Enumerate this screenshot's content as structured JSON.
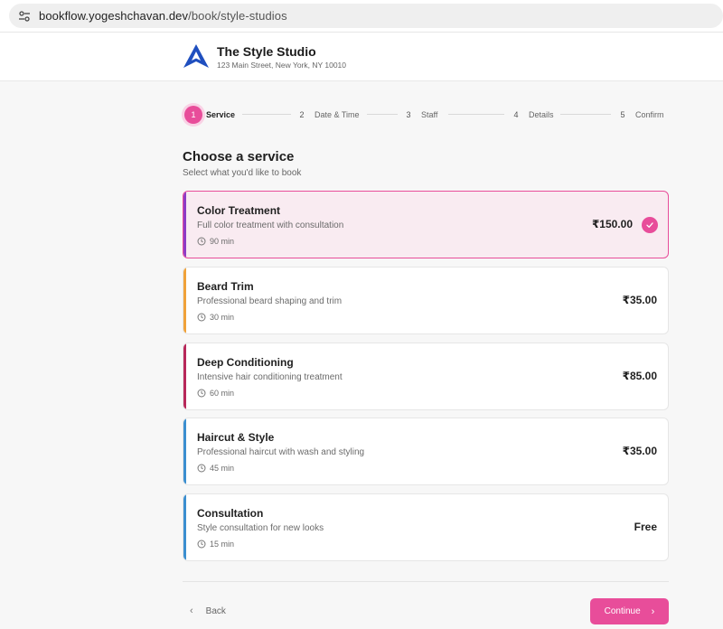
{
  "browser": {
    "url_host": "bookflow.yogeshchavan.dev",
    "url_path": "/book/style-studios"
  },
  "business": {
    "name": "The Style Studio",
    "address": "123 Main Street, New York, NY 10010"
  },
  "steps": [
    {
      "num": "1",
      "label": "Service",
      "active": true
    },
    {
      "num": "2",
      "label": "Date & Time",
      "active": false
    },
    {
      "num": "3",
      "label": "Staff",
      "active": false
    },
    {
      "num": "4",
      "label": "Details",
      "active": false
    },
    {
      "num": "5",
      "label": "Confirm",
      "active": false
    }
  ],
  "heading": {
    "title": "Choose a service",
    "subtitle": "Select what you'd like to book"
  },
  "services": [
    {
      "name": "Color Treatment",
      "description": "Full color treatment with consultation",
      "duration": "90 min",
      "price": "₹150.00",
      "accent": "#8e3cc6",
      "selected": true
    },
    {
      "name": "Beard Trim",
      "description": "Professional beard shaping and trim",
      "duration": "30 min",
      "price": "₹35.00",
      "accent": "#f0a23a",
      "selected": false
    },
    {
      "name": "Deep Conditioning",
      "description": "Intensive hair conditioning treatment",
      "duration": "60 min",
      "price": "₹85.00",
      "accent": "#b8285a",
      "selected": false
    },
    {
      "name": "Haircut & Style",
      "description": "Professional haircut with wash and styling",
      "duration": "45 min",
      "price": "₹35.00",
      "accent": "#3b8fd0",
      "selected": false
    },
    {
      "name": "Consultation",
      "description": "Style consultation for new looks",
      "duration": "15 min",
      "price": "Free",
      "accent": "#3b8fd0",
      "selected": false
    }
  ],
  "footer": {
    "back_label": "Back",
    "continue_label": "Continue"
  },
  "colors": {
    "primary": "#e84d9a",
    "selected_bg": "#f9ebf1",
    "logo": "#1f4fbf"
  }
}
